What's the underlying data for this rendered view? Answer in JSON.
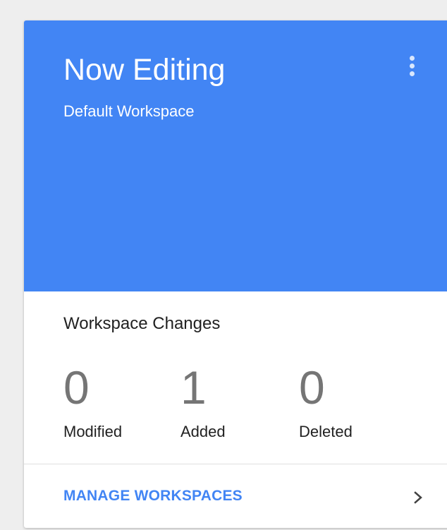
{
  "header": {
    "title": "Now Editing",
    "subtitle": "Default Workspace",
    "menu_icon": "more-vert-icon"
  },
  "changes": {
    "title": "Workspace Changes",
    "stats": [
      {
        "value": "0",
        "label": "Modified"
      },
      {
        "value": "1",
        "label": "Added"
      },
      {
        "value": "0",
        "label": "Deleted"
      }
    ]
  },
  "footer": {
    "link_label": "MANAGE WORKSPACES",
    "chevron_icon": "chevron-right-icon"
  },
  "colors": {
    "accent": "#4285f4",
    "background": "#eeeeee",
    "card": "#ffffff",
    "stat_value": "#757575",
    "text": "#212121"
  }
}
